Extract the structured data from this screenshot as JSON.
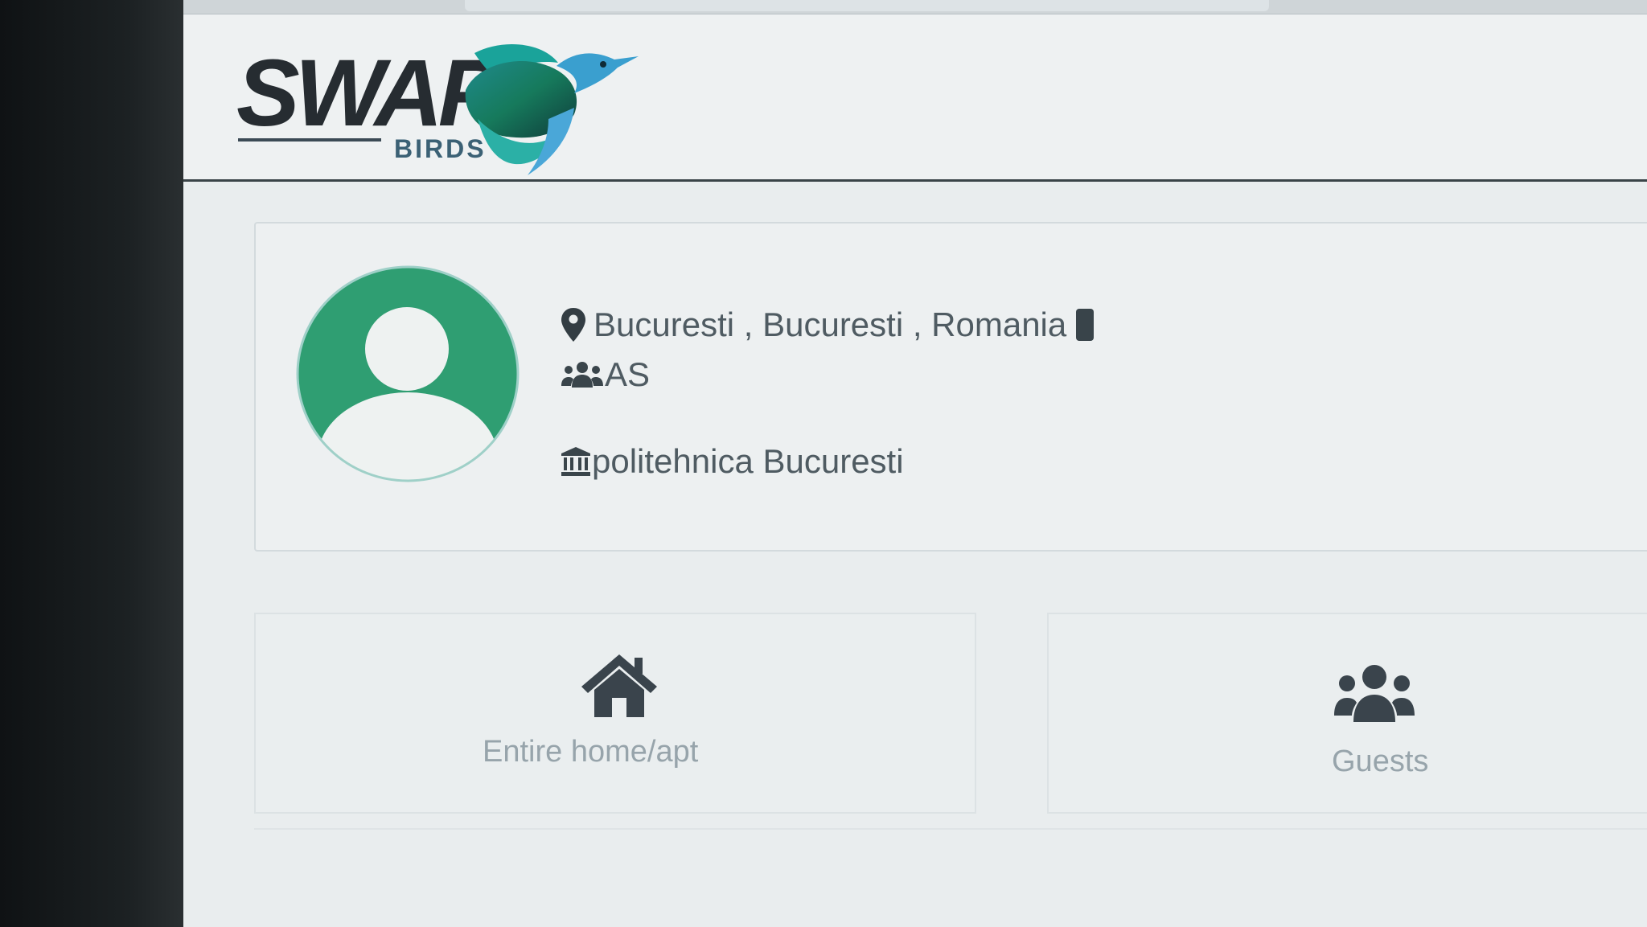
{
  "brand": {
    "name": "SWAP",
    "subname": "BIRDS",
    "colors": {
      "dark": "#262c31",
      "teal": "#1aa39a",
      "green": "#2aa36c",
      "blue": "#4a9ec9"
    }
  },
  "profile": {
    "location": "Bucuresti , Bucuresti , Romania",
    "group": "AS",
    "university": "politehnica Bucuresti",
    "icons": {
      "location": "map-pin-icon",
      "group": "users-icon",
      "university": "institution-icon",
      "phone": "phone-icon"
    },
    "avatar_color": "#2f9e72"
  },
  "features": [
    {
      "label": "Entire home/apt",
      "icon": "home-icon"
    },
    {
      "label": "Guests",
      "icon": "guests-icon"
    }
  ]
}
